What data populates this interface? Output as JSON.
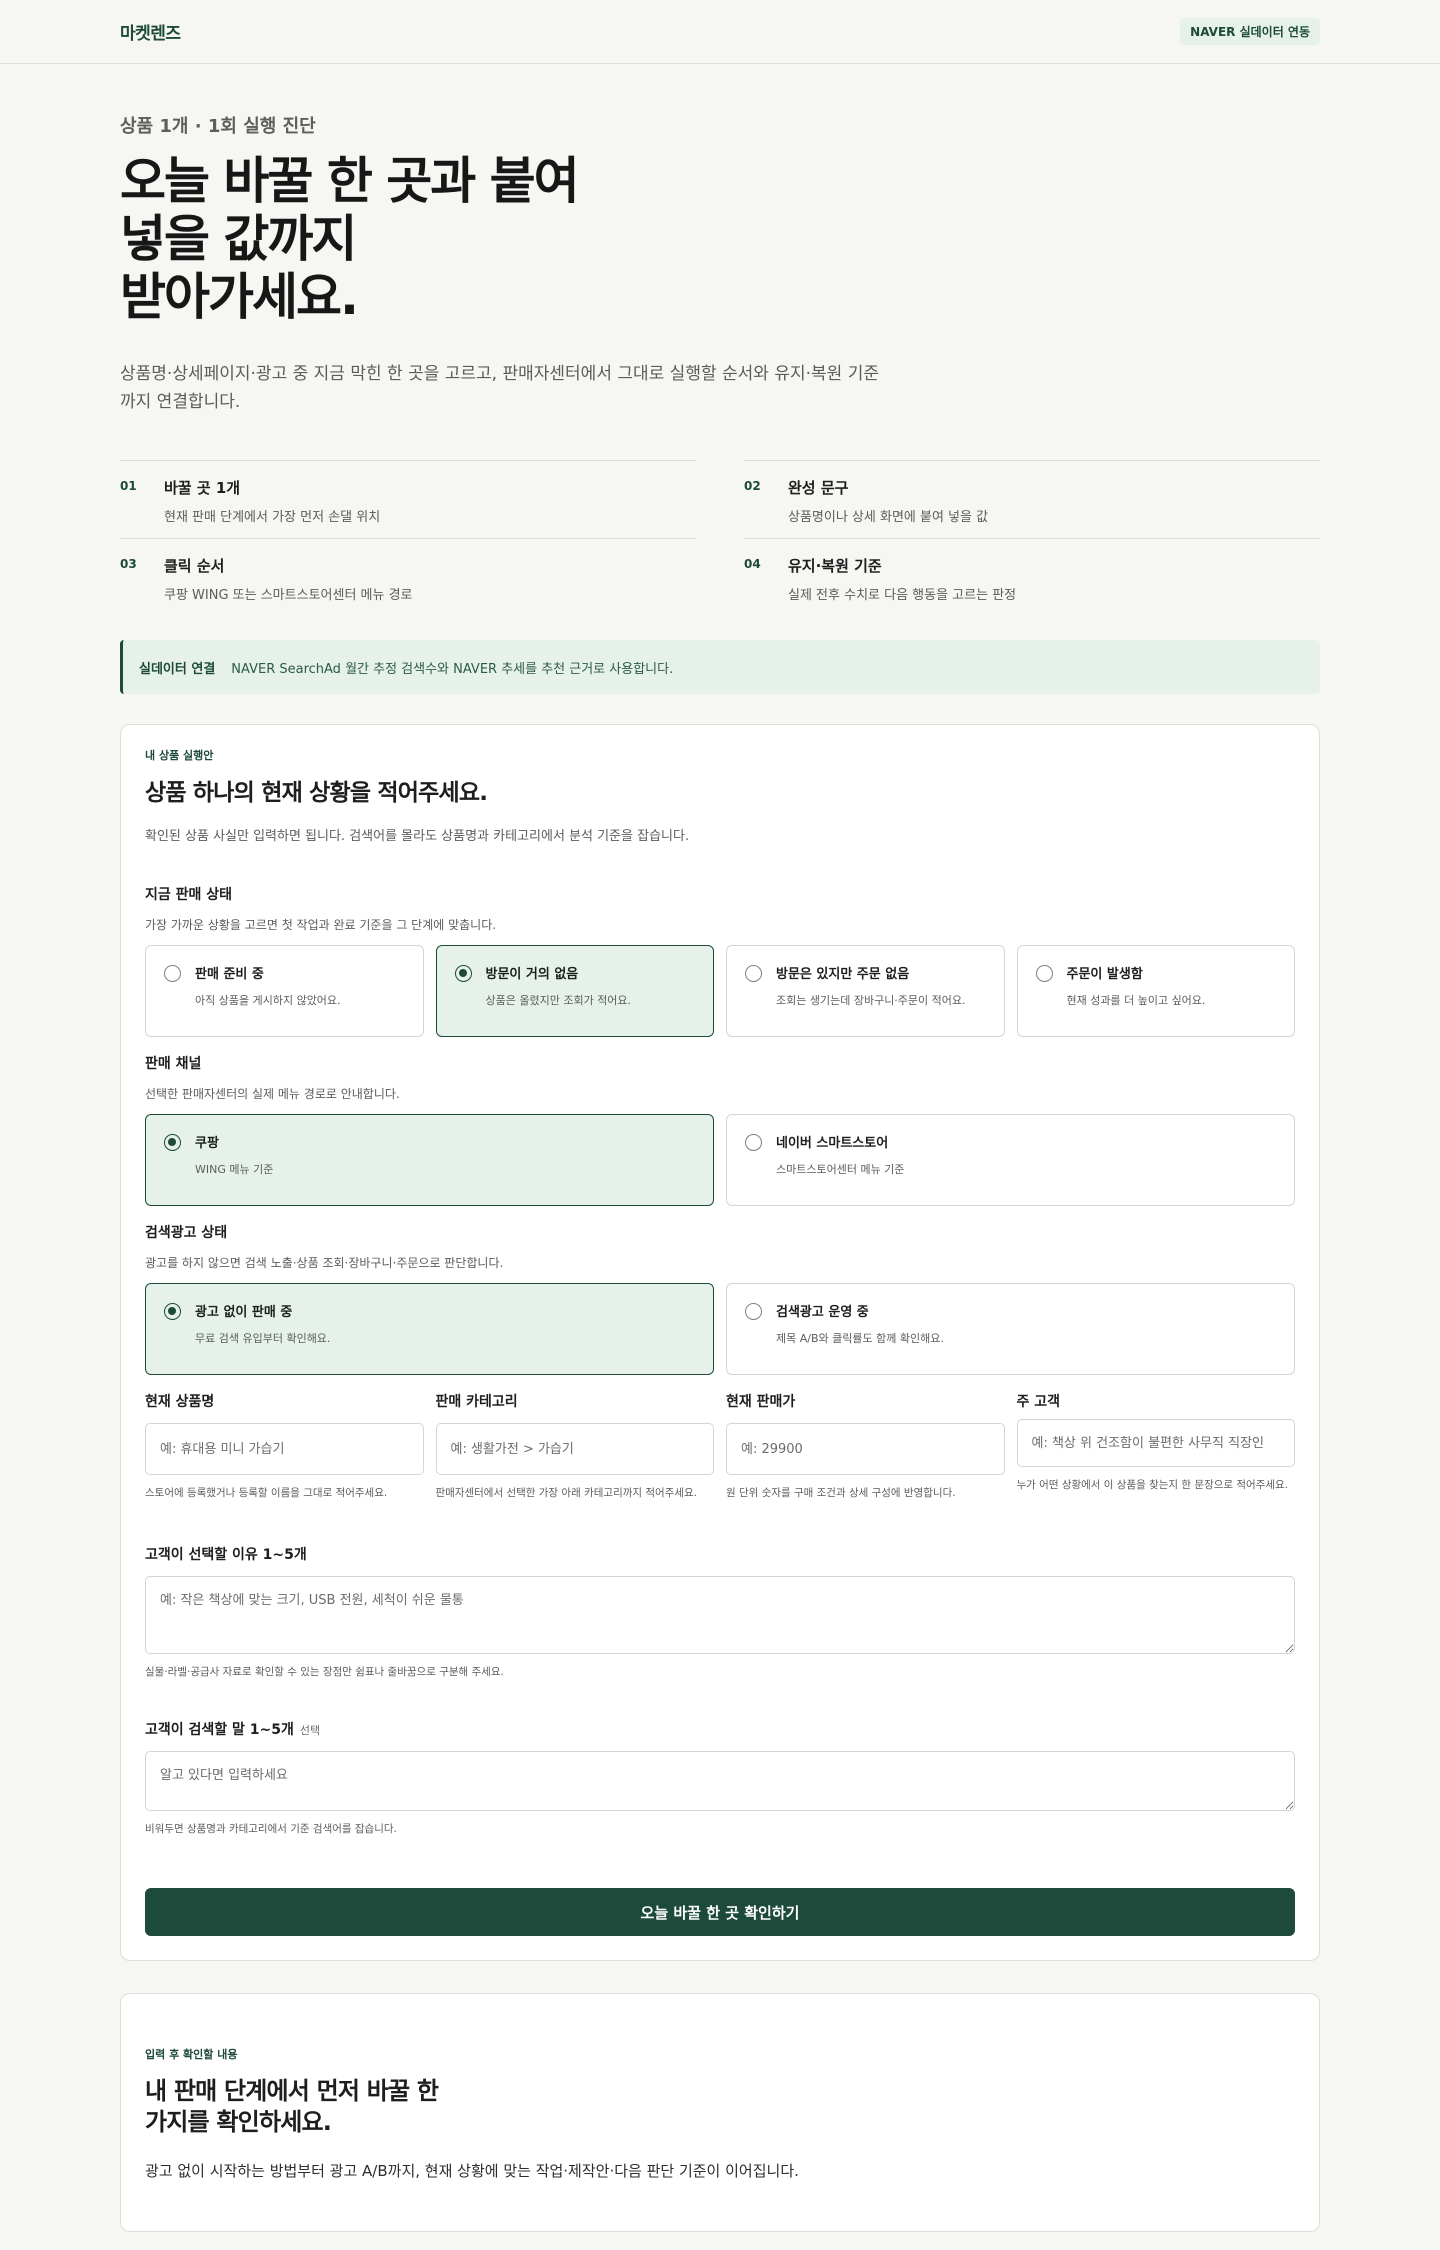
{
  "header": {
    "brand": "마켓렌즈",
    "badge": "NAVER 실데이터 연동"
  },
  "hero": {
    "eyebrow": "상품 1개 · 1회 실행 진단",
    "title": "오늘 바꿀 한 곳과 붙여\n넣을 값까지\n받아가세요.",
    "description": "상품명·상세페이지·광고 중 지금 막힌 한 곳을 고르고, 판매자센터에서 그대로 실행할 순서와 유지·복원 기준까지 연결합니다."
  },
  "features": [
    {
      "num": "01",
      "title": "바꿀 곳 1개",
      "desc": "현재 판매 단계에서 가장 먼저 손댈 위치"
    },
    {
      "num": "02",
      "title": "완성 문구",
      "desc": "상품명이나 상세 화면에 붙여 넣을 값"
    },
    {
      "num": "03",
      "title": "클릭 순서",
      "desc": "쿠팡 WING 또는 스마트스토어센터 메뉴 경로"
    },
    {
      "num": "04",
      "title": "유지·복원 기준",
      "desc": "실제 전후 수치로 다음 행동을 고르는 판정"
    }
  ],
  "notice": {
    "label": "실데이터 연결",
    "text": "NAVER SearchAd 월간 추정 검색수와 NAVER 추세를 추천 근거로 사용합니다."
  },
  "form": {
    "eyebrow": "내 상품 실행안",
    "title": "상품 하나의 현재 상황을 적어주세요.",
    "description": "확인된 상품 사실만 입력하면 됩니다. 검색어를 몰라도 상품명과 카테고리에서 분석 기준을 잡습니다.",
    "stage": {
      "label": "지금 판매 상태",
      "help": "가장 가까운 상황을 고르면 첫 작업과 완료 기준을 그 단계에 맞춥니다.",
      "options": [
        {
          "title": "판매 준비 중",
          "desc": "아직 상품을 게시하지 않았어요."
        },
        {
          "title": "방문이 거의 없음",
          "desc": "상품은 올렸지만 조회가 적어요."
        },
        {
          "title": "방문은 있지만 주문 없음",
          "desc": "조회는 생기는데 장바구니·주문이 적어요."
        },
        {
          "title": "주문이 발생함",
          "desc": "현재 성과를 더 높이고 싶어요."
        }
      ]
    },
    "channel": {
      "label": "판매 채널",
      "help": "선택한 판매자센터의 실제 메뉴 경로로 안내합니다.",
      "options": [
        {
          "title": "쿠팡",
          "desc": "WING 메뉴 기준"
        },
        {
          "title": "네이버 스마트스토어",
          "desc": "스마트스토어센터 메뉴 기준"
        }
      ]
    },
    "ads": {
      "label": "검색광고 상태",
      "help": "광고를 하지 않으면 검색 노출·상품 조회·장바구니·주문으로 판단합니다.",
      "options": [
        {
          "title": "광고 없이 판매 중",
          "desc": "무료 검색 유입부터 확인해요."
        },
        {
          "title": "검색광고 운영 중",
          "desc": "제목 A/B와 클릭률도 함께 확인해요."
        }
      ]
    },
    "fields": [
      {
        "label": "현재 상품명",
        "placeholder": "예: 휴대용 미니 가습기",
        "help": "스토어에 등록했거나 등록할 이름을 그대로 적어주세요."
      },
      {
        "label": "판매 카테고리",
        "placeholder": "예: 생활가전 > 가습기",
        "help": "판매자센터에서 선택한 가장 아래 카테고리까지 적어주세요."
      },
      {
        "label": "현재 판매가",
        "placeholder": "예: 29900",
        "help": "원 단위 숫자를 구매 조건과 상세 구성에 반영합니다."
      },
      {
        "label": "주 고객",
        "placeholder": "예: 책상 위 건조함이 불편한 사무직 직장인",
        "help": "누가 어떤 상황에서 이 상품을 찾는지 한 문장으로 적어주세요."
      }
    ],
    "reasons": {
      "label": "고객이 선택할 이유 1~5개",
      "placeholder": "예: 작은 책상에 맞는 크기, USB 전원, 세척이 쉬운 물통",
      "help": "실물·라벨·공급사 자료로 확인할 수 있는 장점만 쉼표나 줄바꿈으로 구분해 주세요."
    },
    "keywords": {
      "label": "고객이 검색할 말 1~5개",
      "optional": "선택",
      "placeholder": "알고 있다면 입력하세요",
      "help": "비워두면 상품명과 카테고리에서 기준 검색어를 잡습니다."
    },
    "submit": "오늘 바꿀 한 곳 확인하기"
  },
  "result": {
    "eyebrow": "입력 후 확인할 내용",
    "title": "내 판매 단계에서 먼저 바꿀 한\n가지를 확인하세요.",
    "description": "광고 없이 시작하는 방법부터 광고 A/B까지, 현재 상황에 맞는 작업·제작안·다음 판단 기준이 이어집니다."
  }
}
